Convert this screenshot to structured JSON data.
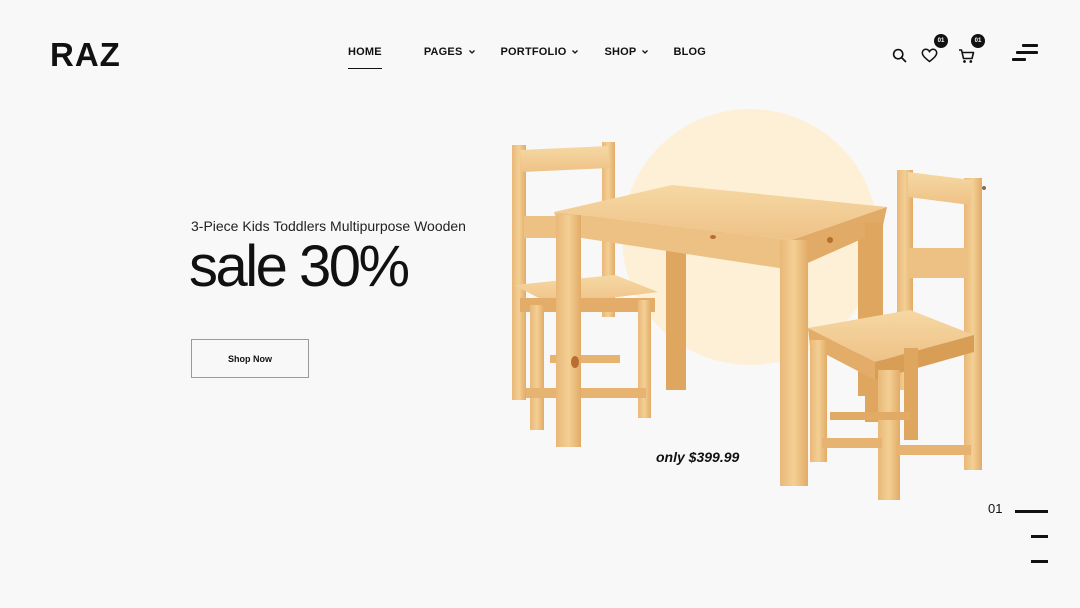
{
  "brand": {
    "logo": "RAZ"
  },
  "nav": {
    "home": "HOME",
    "pages": "PAGES",
    "portfolio": "PORTFOLIO",
    "shop": "SHOP",
    "blog": "BLOG"
  },
  "header": {
    "icons": [
      "search-icon",
      "heart-icon",
      "cart-icon",
      "menu-icon"
    ],
    "wishlist_count": "01",
    "cart_count": "01"
  },
  "hero": {
    "subtitle": "3-Piece Kids Toddlers Multipurpose Wooden",
    "headline": "sale 30%",
    "button_label": "Shop Now",
    "price": "only $399.99"
  },
  "slider": {
    "current": "01",
    "total_slides": 3,
    "active_index": 0
  },
  "colors": {
    "background": "#f8f8f8",
    "accent_circle": "#fdf0d6",
    "text": "#111111",
    "wood": "#e8b97a"
  }
}
